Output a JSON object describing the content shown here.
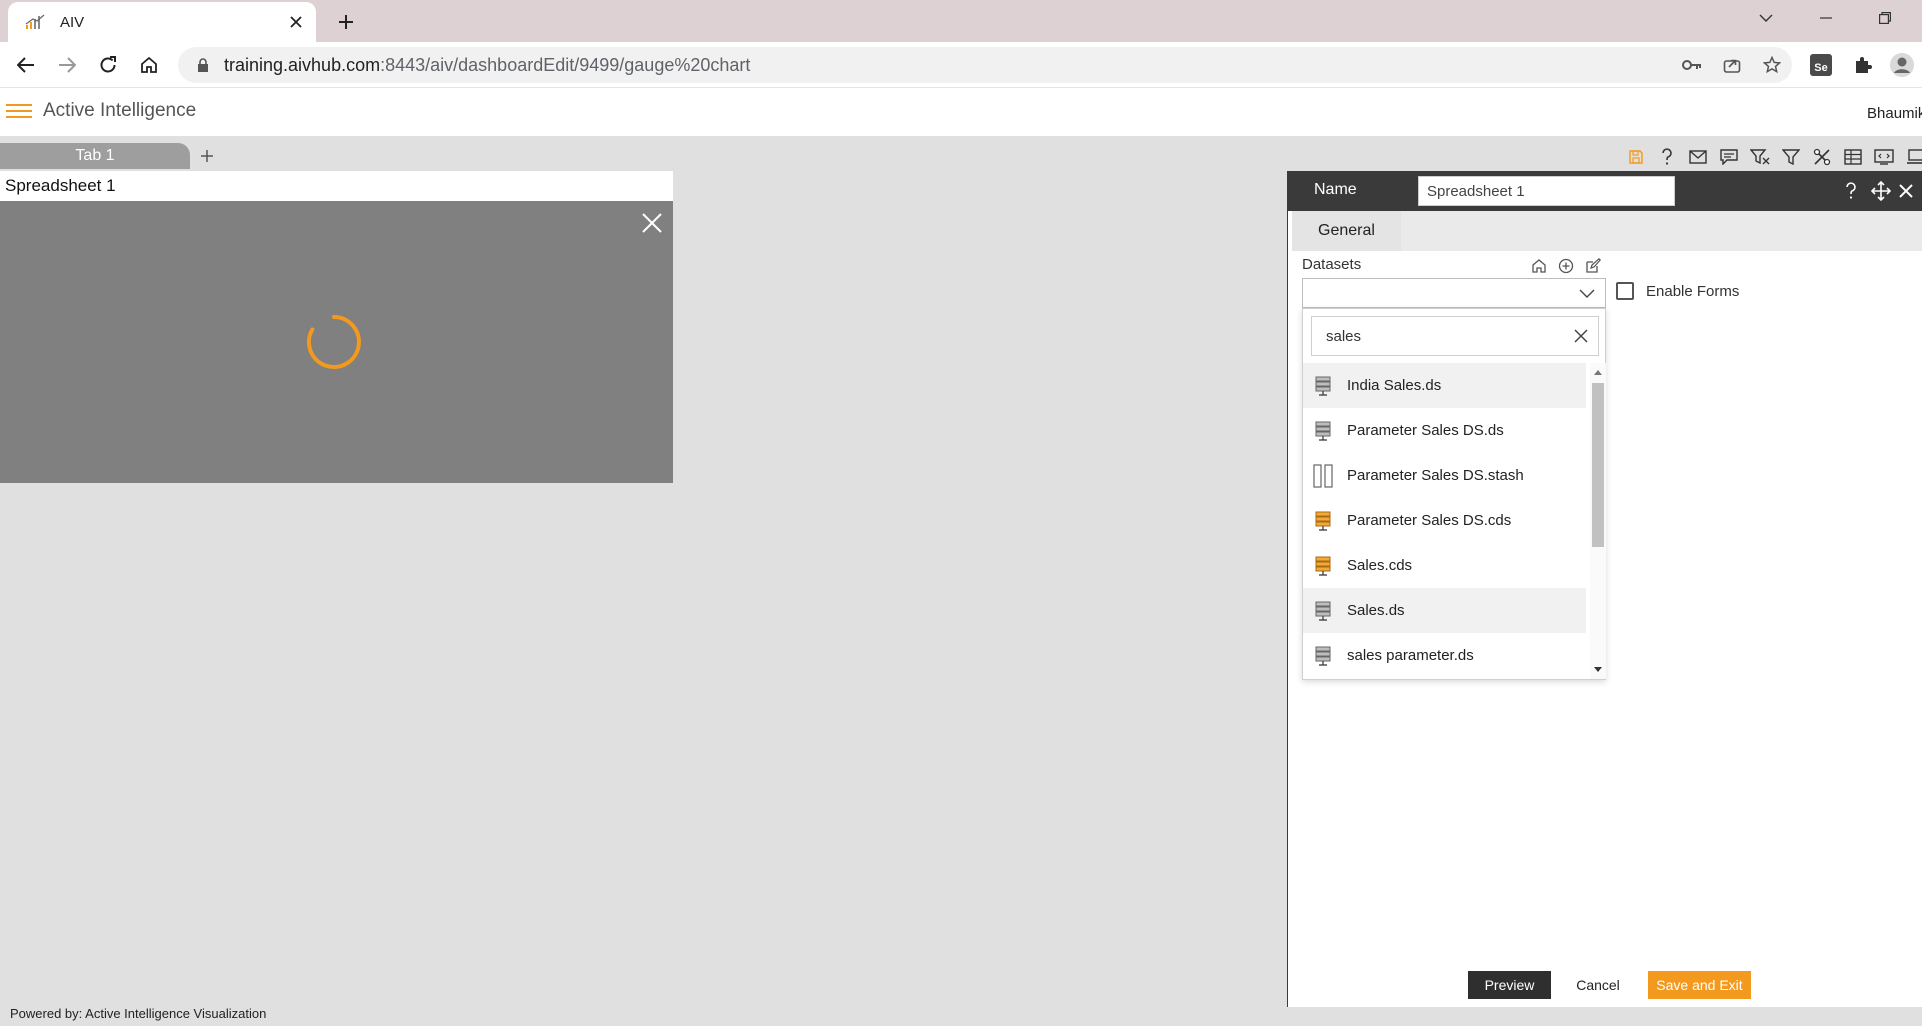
{
  "browser": {
    "tab_title": "AIV",
    "url_host": "training.aivhub.com",
    "url_rest": ":8443/aiv/dashboardEdit/9499/gauge%20chart",
    "extension_label": "Se"
  },
  "app": {
    "title": "Active Intelligence",
    "user": "Bhaumik",
    "footer": "Powered by: Active Intelligence Visualization"
  },
  "dashboard": {
    "tabs": [
      {
        "label": "Tab 1"
      }
    ],
    "add_tab_symbol": "+"
  },
  "widget": {
    "title": "Spreadsheet 1"
  },
  "panel": {
    "name_label": "Name",
    "name_value": "Spreadsheet 1",
    "tab_general": "General",
    "datasets_label": "Datasets",
    "enable_forms_label": "Enable Forms",
    "search_value": "sales",
    "dataset_items": [
      {
        "label": "India Sales.ds",
        "icon": "database-icon"
      },
      {
        "label": "Parameter Sales DS.ds",
        "icon": "database-icon"
      },
      {
        "label": "Parameter Sales DS.stash",
        "icon": "stash-icon"
      },
      {
        "label": "Parameter Sales DS.cds",
        "icon": "cached-database-icon"
      },
      {
        "label": "Sales.cds",
        "icon": "cached-database-icon"
      },
      {
        "label": "Sales.ds",
        "icon": "database-icon"
      },
      {
        "label": "sales parameter.ds",
        "icon": "database-icon"
      }
    ],
    "buttons": {
      "preview": "Preview",
      "cancel": "Cancel",
      "save_exit": "Save and Exit"
    }
  },
  "colors": {
    "accent": "#f39a1e",
    "panel_header": "#3a3a3a",
    "widget_body": "#808080",
    "canvas": "#e0e0e0"
  }
}
